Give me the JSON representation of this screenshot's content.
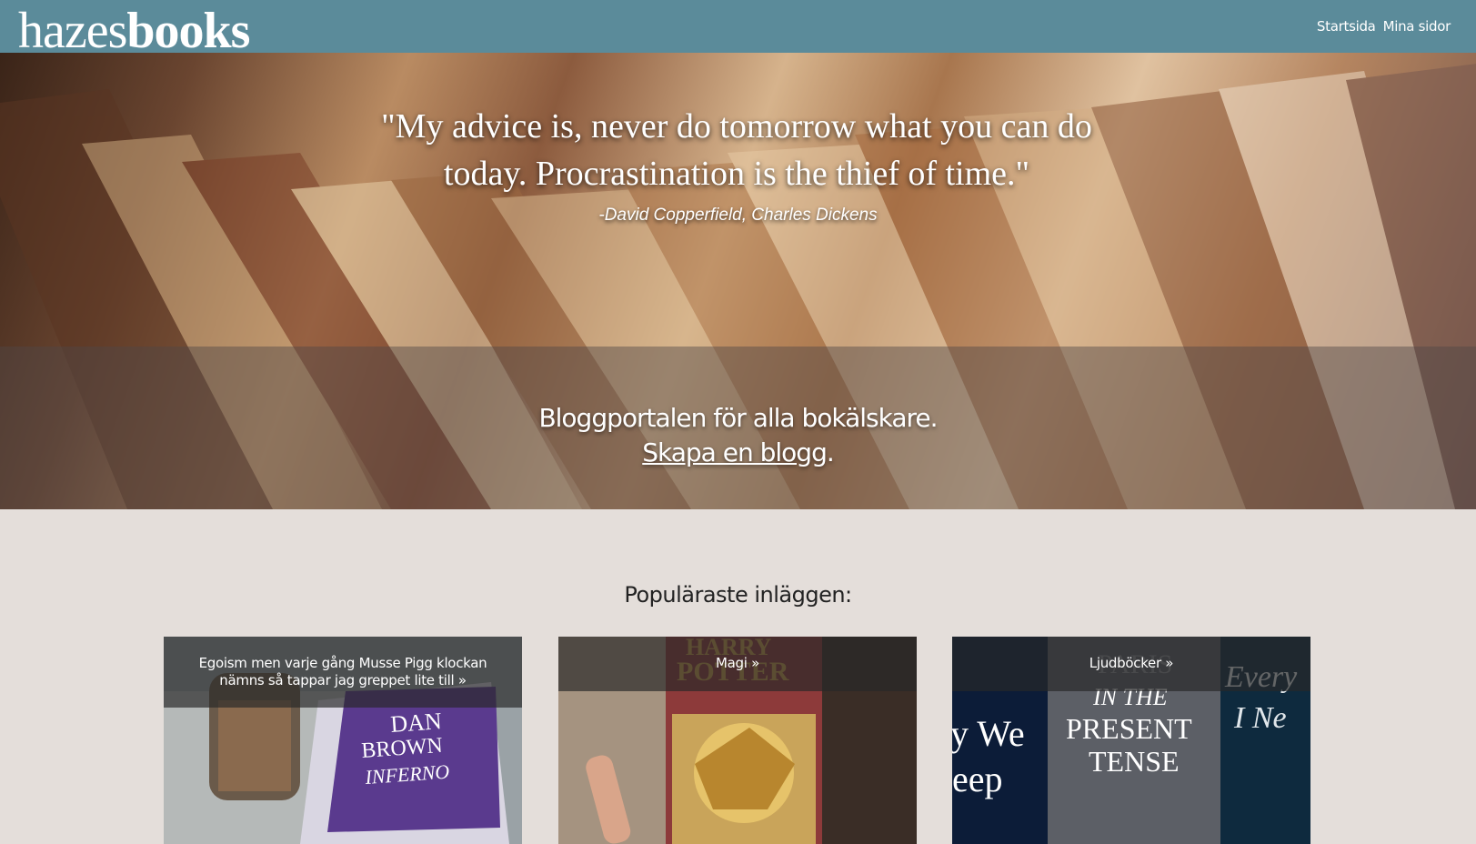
{
  "header": {
    "logo_light": "hazes",
    "logo_bold": "books",
    "nav": [
      {
        "label": "Startsida"
      },
      {
        "label": "Mina sidor"
      }
    ]
  },
  "hero": {
    "quote": "\"My advice is, never do tomorrow what you can do today. Procrastination is the thief of time.\"",
    "author": "-David Copperfield, Charles Dickens",
    "tagline": "Bloggportalen för alla bokälskare.",
    "cta_link": "Skapa en blogg",
    "cta_suffix": "."
  },
  "popular": {
    "title": "Populäraste inläggen:",
    "posts": [
      {
        "caption": "Egoism men varje gång Musse Pigg klockan nämns så tappar jag greppet lite till »",
        "cover_text": "DAN BROWN INFERNO"
      },
      {
        "caption": "Magi »",
        "cover_text": "HARRY POTTER"
      },
      {
        "caption": "Ljudböcker »",
        "cover_text": "PARIS IN THE PRESENT TENSE"
      }
    ]
  },
  "colors": {
    "header_bg": "#5b8b9a",
    "page_bg": "#e4deda"
  }
}
